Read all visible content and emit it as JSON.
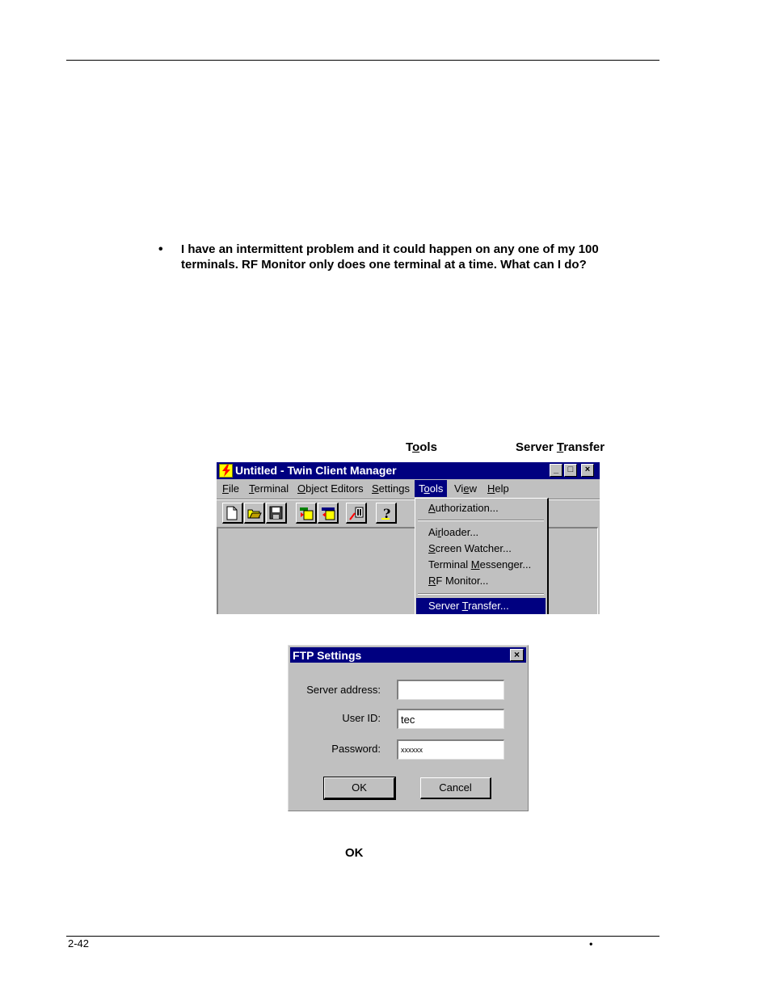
{
  "page": {
    "bullet_text": "I have an intermittent problem and it could happen on any one of my 100 terminals. RF Monitor only does one terminal at a time. What can I do?",
    "inline_labels": {
      "tools": {
        "pre": "T",
        "ul": "o",
        "post": "ols"
      },
      "server_transfer": {
        "pre": "Server ",
        "ul": "T",
        "post": "ransfer"
      },
      "ok": "OK"
    },
    "footer": {
      "page_number": "2-42",
      "mark": "•"
    }
  },
  "app_window": {
    "title": "Untitled - Twin Client Manager",
    "menu": [
      {
        "u": "F",
        "rest": "ile"
      },
      {
        "u": "T",
        "rest": "erminal"
      },
      {
        "u": "O",
        "rest": "bject Editors"
      },
      {
        "u": "S",
        "rest": "ettings"
      },
      {
        "pre": "T",
        "u": "o",
        "rest": "ols"
      },
      {
        "pre": "Vi",
        "u": "e",
        "rest": "w"
      },
      {
        "u": "H",
        "rest": "elp"
      }
    ],
    "tools_menu": [
      {
        "pre": "",
        "u": "A",
        "rest": "uthorization..."
      },
      {
        "pre": "Ai",
        "u": "r",
        "rest": "loader..."
      },
      {
        "pre": "",
        "u": "S",
        "rest": "creen Watcher..."
      },
      {
        "pre": "Terminal ",
        "u": "M",
        "rest": "essenger..."
      },
      {
        "pre": "",
        "u": "R",
        "rest": "F Monitor..."
      },
      {
        "pre": "Server ",
        "u": "T",
        "rest": "ransfer..."
      }
    ]
  },
  "ftp_dialog": {
    "title": "FTP Settings",
    "server_label": "Server address:",
    "server_value": "",
    "userid_label": "User ID:",
    "userid_value": "tec",
    "password_label": "Password:",
    "password_value": "xxxxxx",
    "ok_label": "OK",
    "cancel_label": "Cancel"
  },
  "colors": {
    "titlebar": "#000080",
    "face": "#c0c0c0",
    "highlight": "#000080"
  }
}
